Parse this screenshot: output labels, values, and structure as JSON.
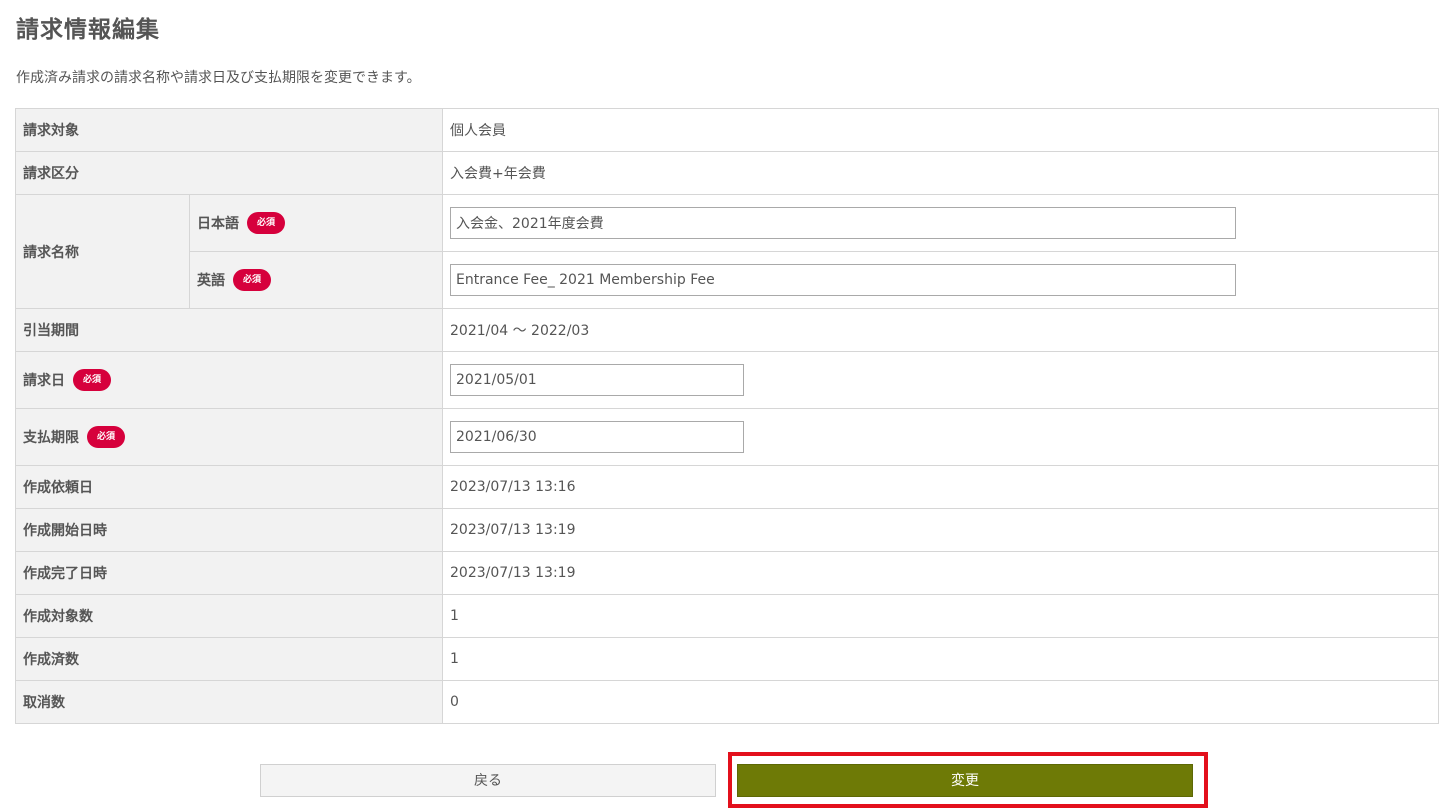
{
  "header": {
    "title": "請求情報編集",
    "description": "作成済み請求の請求名称や請求日及び支払期限を変更できます。"
  },
  "badge": {
    "required": "必須"
  },
  "rows": {
    "target": {
      "label": "請求対象",
      "value": "個人会員"
    },
    "category": {
      "label": "請求区分",
      "value": "入会費+年会費"
    },
    "name": {
      "label": "請求名称",
      "ja_label": "日本語",
      "ja_value": "入会金、2021年度会費",
      "en_label": "英語",
      "en_value": "Entrance Fee_ 2021 Membership Fee"
    },
    "period": {
      "label": "引当期間",
      "value": "2021/04 ～ 2022/03"
    },
    "billing_date": {
      "label": "請求日",
      "value": "2021/05/01"
    },
    "due_date": {
      "label": "支払期限",
      "value": "2021/06/30"
    },
    "requested_at": {
      "label": "作成依頼日",
      "value": "2023/07/13 13:16"
    },
    "started_at": {
      "label": "作成開始日時",
      "value": "2023/07/13 13:19"
    },
    "completed_at": {
      "label": "作成完了日時",
      "value": "2023/07/13 13:19"
    },
    "target_count": {
      "label": "作成対象数",
      "value": "1"
    },
    "created_count": {
      "label": "作成済数",
      "value": "1"
    },
    "cancelled_count": {
      "label": "取消数",
      "value": "0"
    }
  },
  "buttons": {
    "back": "戻る",
    "submit": "変更"
  },
  "colors": {
    "submit_button": "#6e7a06",
    "required_badge": "#d6003c",
    "highlight_frame": "#e3101c",
    "header_cell": "#f2f2f2"
  }
}
